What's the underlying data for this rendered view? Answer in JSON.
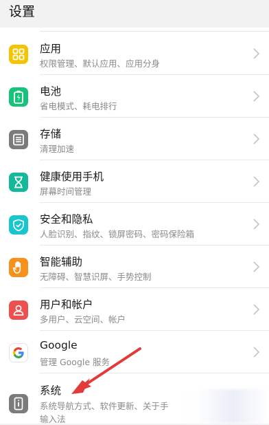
{
  "header": {
    "title": "设置"
  },
  "colors": {
    "yellow": "#f5c400",
    "green": "#17c27a",
    "gray": "#7b7b7b",
    "teal": "#14b89a",
    "cyan": "#18c6cf",
    "orange": "#f5921e",
    "red": "#ee5050",
    "chevron": "#c4c4c4",
    "arrow": "#e23b3b"
  },
  "rows": [
    {
      "title": "应用",
      "subtitle": "权限管理、默认应用、应用分身",
      "icon": "apps-grid-icon"
    },
    {
      "title": "电池",
      "subtitle": "省电模式、耗电排行",
      "icon": "battery-icon"
    },
    {
      "title": "存储",
      "subtitle": "清理加速",
      "icon": "storage-icon"
    },
    {
      "title": "健康使用手机",
      "subtitle": "屏幕时间管理",
      "icon": "hourglass-icon"
    },
    {
      "title": "安全和隐私",
      "subtitle": "人脸识别、指纹、锁屏密码、密码保险箱",
      "icon": "shield-icon"
    },
    {
      "title": "智能辅助",
      "subtitle": "无障碍、智慧识屏、手势控制",
      "icon": "hand-icon"
    },
    {
      "title": "用户和帐户",
      "subtitle": "多用户、云空间、帐户",
      "icon": "user-icon"
    },
    {
      "title": "Google",
      "subtitle": "管理 Google 服务",
      "icon": "google-icon"
    },
    {
      "title": "系统",
      "subtitle": "系统导航方式、软件更新、关于手",
      "subtitle2": "输入法",
      "icon": "phone-info-icon"
    }
  ]
}
